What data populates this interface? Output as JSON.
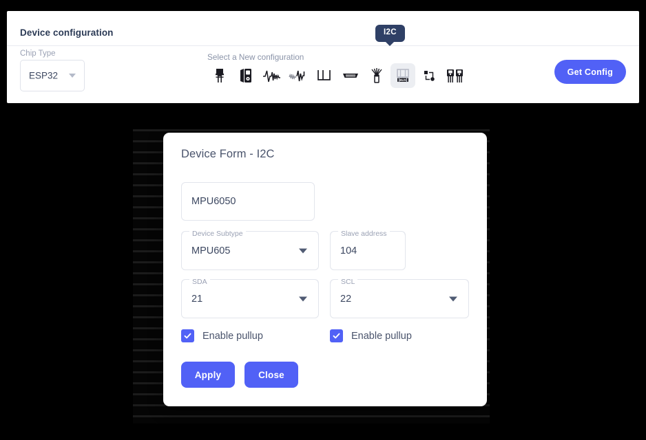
{
  "panel": {
    "title": "Device configuration",
    "chip_type": {
      "label": "Chip Type",
      "value": "ESP32"
    },
    "select_config_label": "Select a New configuration",
    "get_config_label": "Get Config",
    "tooltip": "I2C",
    "icons": [
      {
        "name": "led-icon",
        "selected": false
      },
      {
        "name": "display-module-icon",
        "selected": false
      },
      {
        "name": "waveform-pulse-icon",
        "selected": false
      },
      {
        "name": "waveform-noise-icon",
        "selected": false
      },
      {
        "name": "square-wave-icon",
        "selected": false
      },
      {
        "name": "db9-connector-icon",
        "selected": false
      },
      {
        "name": "antenna-icon",
        "selected": false
      },
      {
        "name": "i2c-bus-icon",
        "selected": true
      },
      {
        "name": "node-graph-icon",
        "selected": false
      },
      {
        "name": "transistor-pair-icon",
        "selected": false
      }
    ]
  },
  "dialog": {
    "title": "Device Form - I2C",
    "device_name": {
      "value": "MPU6050"
    },
    "device_subtype": {
      "label": "Device Subtype",
      "value": "MPU605"
    },
    "slave_address": {
      "label": "Slave address",
      "value": "104"
    },
    "sda": {
      "label": "SDA",
      "value": "21"
    },
    "scl": {
      "label": "SCL",
      "value": "22"
    },
    "pullup_sda_label": "Enable pullup",
    "pullup_scl_label": "Enable pullup",
    "apply_label": "Apply",
    "close_label": "Close"
  },
  "colors": {
    "accent": "#5161f6",
    "tooltip_bg": "#2f4066",
    "text": "#49536b",
    "label": "#9aa1b4",
    "border": "#e2e5ec",
    "selected_icon_bg": "#eceef2"
  }
}
